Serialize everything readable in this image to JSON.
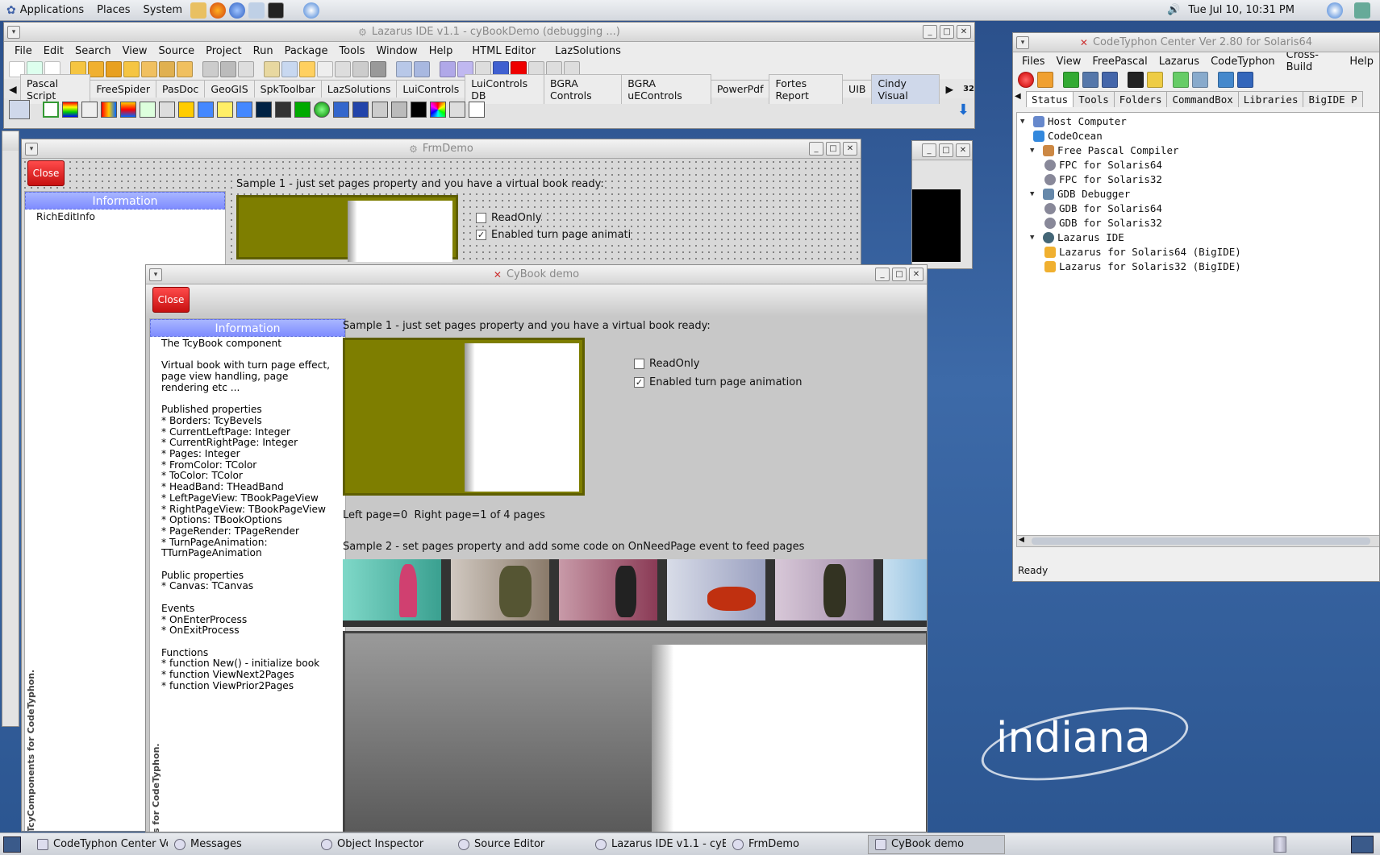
{
  "top_panel": {
    "menus": [
      "Applications",
      "Places",
      "System"
    ],
    "datetime": "Tue Jul 10, 10:31 PM"
  },
  "ide": {
    "title": "Lazarus IDE v1.1 - cyBookDemo (debugging ...)",
    "menu": [
      "File",
      "Edit",
      "Search",
      "View",
      "Source",
      "Project",
      "Run",
      "Package",
      "Tools",
      "Window",
      "Help",
      "HTML Editor",
      "LazSolutions"
    ],
    "component_tabs": [
      "Pascal Script",
      "FreeSpider",
      "PasDoc",
      "GeoGIS",
      "SpkToolbar",
      "LazSolutions",
      "LuiControls",
      "LuiControls DB",
      "BGRA Controls",
      "BGRA uEControls",
      "PowerPdf",
      "Fortes Report",
      "UIB",
      "Cindy Visual"
    ],
    "badge": "32"
  },
  "frmdemo": {
    "title": "FrmDemo",
    "close_label": "Close",
    "info_header": "Information",
    "info_item": "RichEditInfo",
    "sample1": "Sample 1 - just set pages property and you have a virtual book ready:",
    "readonly": "ReadOnly",
    "animation": "Enabled turn page animati",
    "side_caption": "TcyComponents for CodeTyphon."
  },
  "cybook": {
    "title": "CyBook demo",
    "close_label": "Close",
    "info_header": "Information",
    "info_text": "The TcyBook component\n\nVirtual book with turn page effect,\npage view handling, page\nrendering etc ...\n\nPublished properties\n* Borders: TcyBevels\n* CurrentLeftPage: Integer\n* CurrentRightPage: Integer\n* Pages: Integer\n* FromColor: TColor\n* ToColor: TColor\n* HeadBand: THeadBand\n* LeftPageView: TBookPageView\n* RightPageView: TBookPageView\n* Options: TBookOptions\n* PageRender: TPageRender\n* TurnPageAnimation:\nTTurnPageAnimation\n\nPublic properties\n* Canvas: TCanvas\n\nEvents\n* OnEnterProcess\n* OnExitProcess\n\nFunctions\n* function New() - initialize book\n* function ViewNext2Pages\n* function ViewPrior2Pages",
    "sample1": "Sample 1 - just set pages property and you have a virtual book ready:",
    "readonly": "ReadOnly",
    "animation": "Enabled turn page animation",
    "page_status": "Left page=0  Right page=1 of 4 pages",
    "sample2": "Sample 2 - set pages property and add some code on OnNeedPage event to feed pages",
    "side_caption": "s for CodeTyphon."
  },
  "codetyphon": {
    "title": "CodeTyphon Center Ver 2.80 for Solaris64",
    "menu": [
      "Files",
      "View",
      "FreePascal",
      "Lazarus",
      "CodeTyphon",
      "Cross-Build",
      "Help"
    ],
    "tabs": [
      "Status",
      "Tools",
      "Folders",
      "CommandBox",
      "Libraries",
      "BigIDE P"
    ],
    "tree": [
      {
        "label": "Host Computer",
        "level": 0
      },
      {
        "label": "CodeOcean",
        "level": 1
      },
      {
        "label": "Free Pascal Compiler",
        "level": 0
      },
      {
        "label": "FPC for Solaris64",
        "level": 1
      },
      {
        "label": "FPC for Solaris32",
        "level": 1
      },
      {
        "label": "GDB Debugger",
        "level": 0
      },
      {
        "label": "GDB for Solaris64",
        "level": 1
      },
      {
        "label": "GDB for Solaris32",
        "level": 1
      },
      {
        "label": "Lazarus IDE",
        "level": 0
      },
      {
        "label": "Lazarus for Solaris64 (BigIDE)",
        "level": 1
      },
      {
        "label": "Lazarus for Solaris32 (BigIDE)",
        "level": 1
      }
    ],
    "status": "Ready"
  },
  "desktop": {
    "logo_text": "indiana"
  },
  "taskbar": [
    "CodeTyphon Center Ve...",
    "Messages",
    "Object Inspector",
    "Source Editor",
    "Lazarus IDE v1.1 - cyBo...",
    "FrmDemo",
    "CyBook demo"
  ],
  "colors": {
    "info_header": "#8b96ff",
    "close_button": "#e02020",
    "book_bg": "#7e7e00"
  }
}
